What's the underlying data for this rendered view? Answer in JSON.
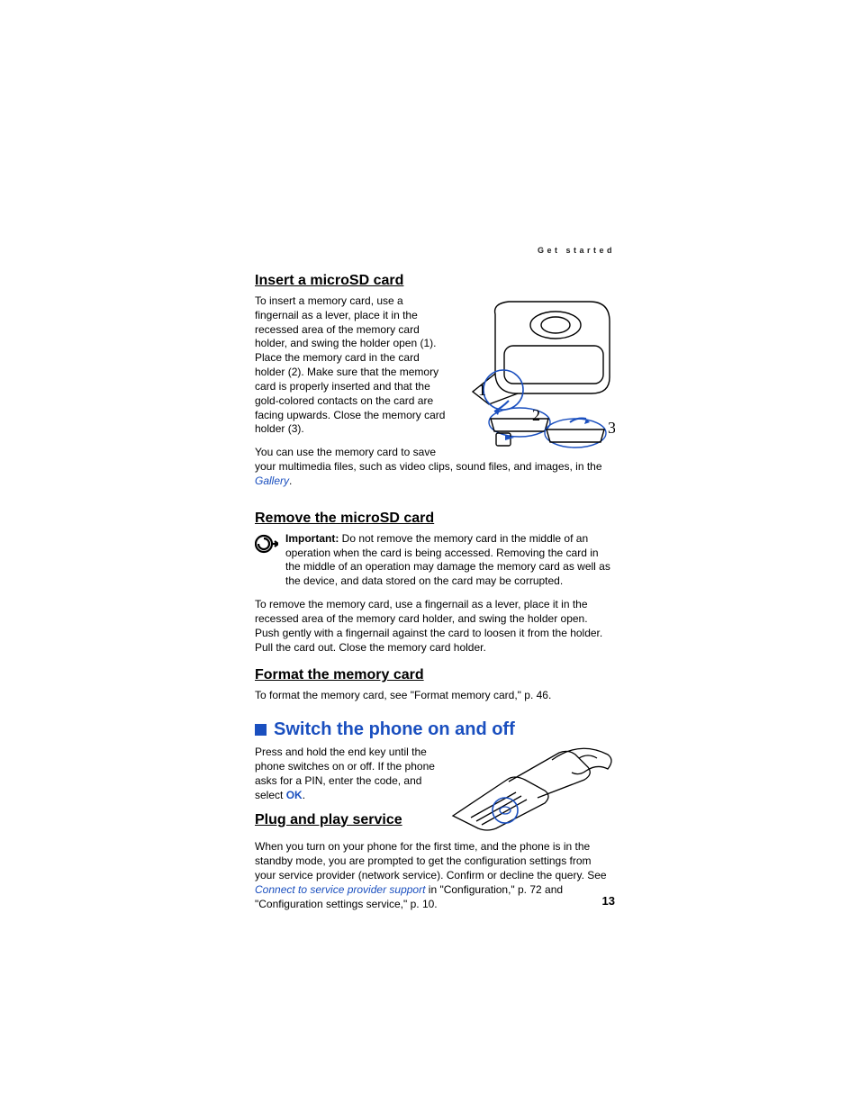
{
  "runningHead": "Get started",
  "pageNumber": "13",
  "insert": {
    "title": "Insert a microSD card",
    "p1a": "To insert a memory card, use a fingernail as a lever, place it in the recessed area of the memory card holder, and swing the holder open (1). Place the memory card in the card holder (2). Make sure that the memory card is properly inserted and that the gold-colored contacts on the card are facing upwards. Close the memory card holder (3).",
    "p2a": "You can use the memory card to save your multimedia files, such as video clips, sound files, and images, in the ",
    "p2link": "Gallery",
    "p2b": "."
  },
  "remove": {
    "title": "Remove the microSD card",
    "impLabel": "Important:",
    "impText": " Do not remove the memory card in the middle of an operation when the card is being accessed. Removing the card in the middle of an operation may damage the memory card as well as the device, and data stored on the card may be corrupted.",
    "p1": "To remove the memory card, use a fingernail as a lever, place it in the recessed area of the memory card holder, and swing the holder open. Push gently with a fingernail against the card to loosen it from the holder. Pull the card out. Close the memory card holder."
  },
  "format": {
    "title": "Format the memory card",
    "p1": "To format the memory card, see \"Format memory card,\" p. 46."
  },
  "switch": {
    "title": "Switch the phone on and off",
    "p1a": "Press and hold the end key until the phone switches on or off. If the phone asks for a PIN, enter the code, and select ",
    "ok": "OK",
    "p1b": "."
  },
  "plug": {
    "title": "Plug and play service",
    "p1a": "When you turn on your phone for the first time, and the phone is in the standby mode, you are prompted to get the configuration settings from your service provider (network service). Confirm or decline the query. See ",
    "link": "Connect to service provider support",
    "p1b": " in \"Configuration,\" p. 72 and \"Configuration settings service,\" p. 10."
  }
}
